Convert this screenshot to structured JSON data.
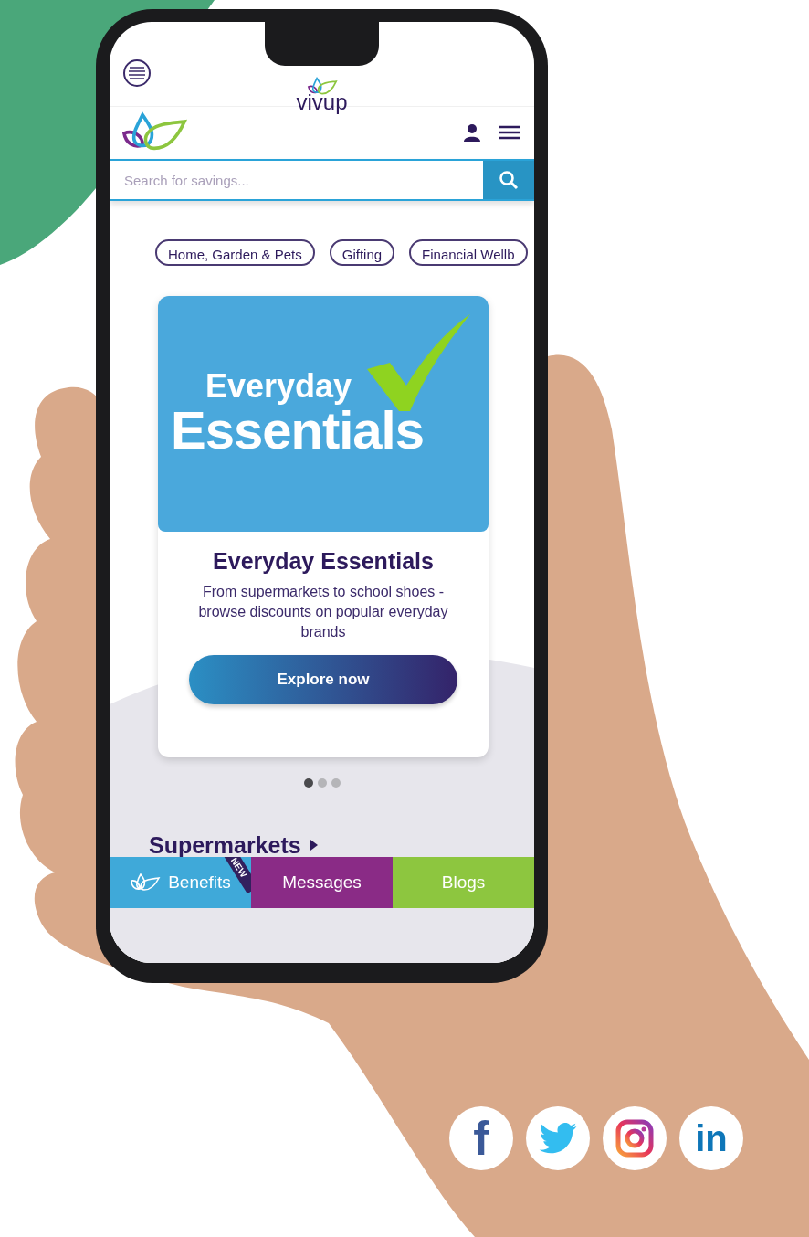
{
  "top_bar": {
    "brand": "vivup"
  },
  "search": {
    "placeholder": "Search for savings..."
  },
  "categories": [
    "Home, Garden & Pets",
    "Gifting",
    "Financial Wellb"
  ],
  "banner": {
    "line_1": "Everyday",
    "line_2": "Essentials"
  },
  "card": {
    "title": "Everyday Essentials",
    "description": "From supermarkets to school shoes - browse discounts on popular everyday brands",
    "button": "Explore now"
  },
  "carousel_dots": [
    {
      "selected": true
    },
    {
      "selected": false
    },
    {
      "selected": false
    }
  ],
  "section_heading": "Supermarkets",
  "bottom_nav": [
    {
      "label": "Benefits",
      "color": "#3fa9d9",
      "badge": "NEW"
    },
    {
      "label": "Messages",
      "color": "#8a2b86"
    },
    {
      "label": "Blogs",
      "color": "#8dc63f"
    }
  ],
  "social": [
    {
      "kind": "facebook",
      "label": "f"
    },
    {
      "kind": "twitter"
    },
    {
      "kind": "instagram"
    },
    {
      "kind": "linkedin",
      "label": "in"
    }
  ]
}
